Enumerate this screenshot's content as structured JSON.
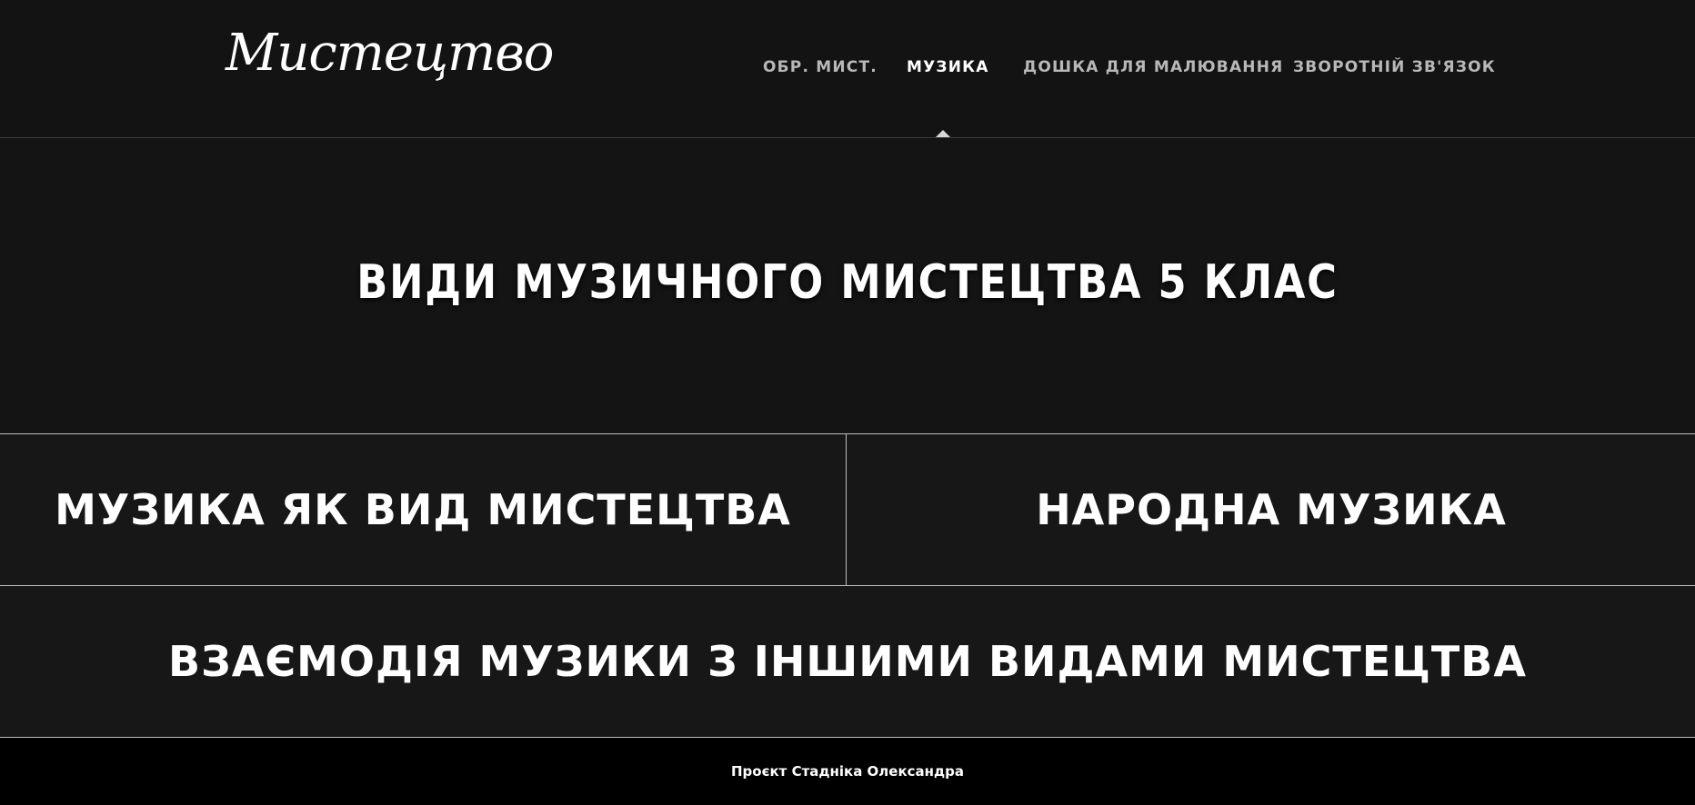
{
  "header": {
    "logo_text": "Мистецтво",
    "nav": [
      {
        "label": "ОБР. МИСТ.",
        "active": false
      },
      {
        "label": "МУЗИКА",
        "active": true
      },
      {
        "label": "ДОШКА ДЛЯ МАЛЮВАННЯ",
        "active": false
      },
      {
        "label": "ЗВОРОТНІЙ ЗВ'ЯЗОК",
        "active": false
      }
    ]
  },
  "hero": {
    "title": "ВИДИ МУЗИЧНОГО МИСТЕЦТВА 5 КЛАС"
  },
  "tiles": [
    {
      "label": "МУЗИКА ЯК ВИД МИСТЕЦТВА"
    },
    {
      "label": "НАРОДНА МУЗИКА"
    },
    {
      "label": "ВЗАЄМОДІЯ МУЗИКИ З ІНШИМИ ВИДАМИ МИСТЕЦТВА"
    }
  ],
  "footer": {
    "text": "Проєкт Стадніка Олександра"
  },
  "colors": {
    "background": "#141414",
    "footer_background": "#000000",
    "nav_inactive": "#b8b8b8",
    "nav_active": "#ffffff",
    "tile_border": "#bdbdbd"
  }
}
